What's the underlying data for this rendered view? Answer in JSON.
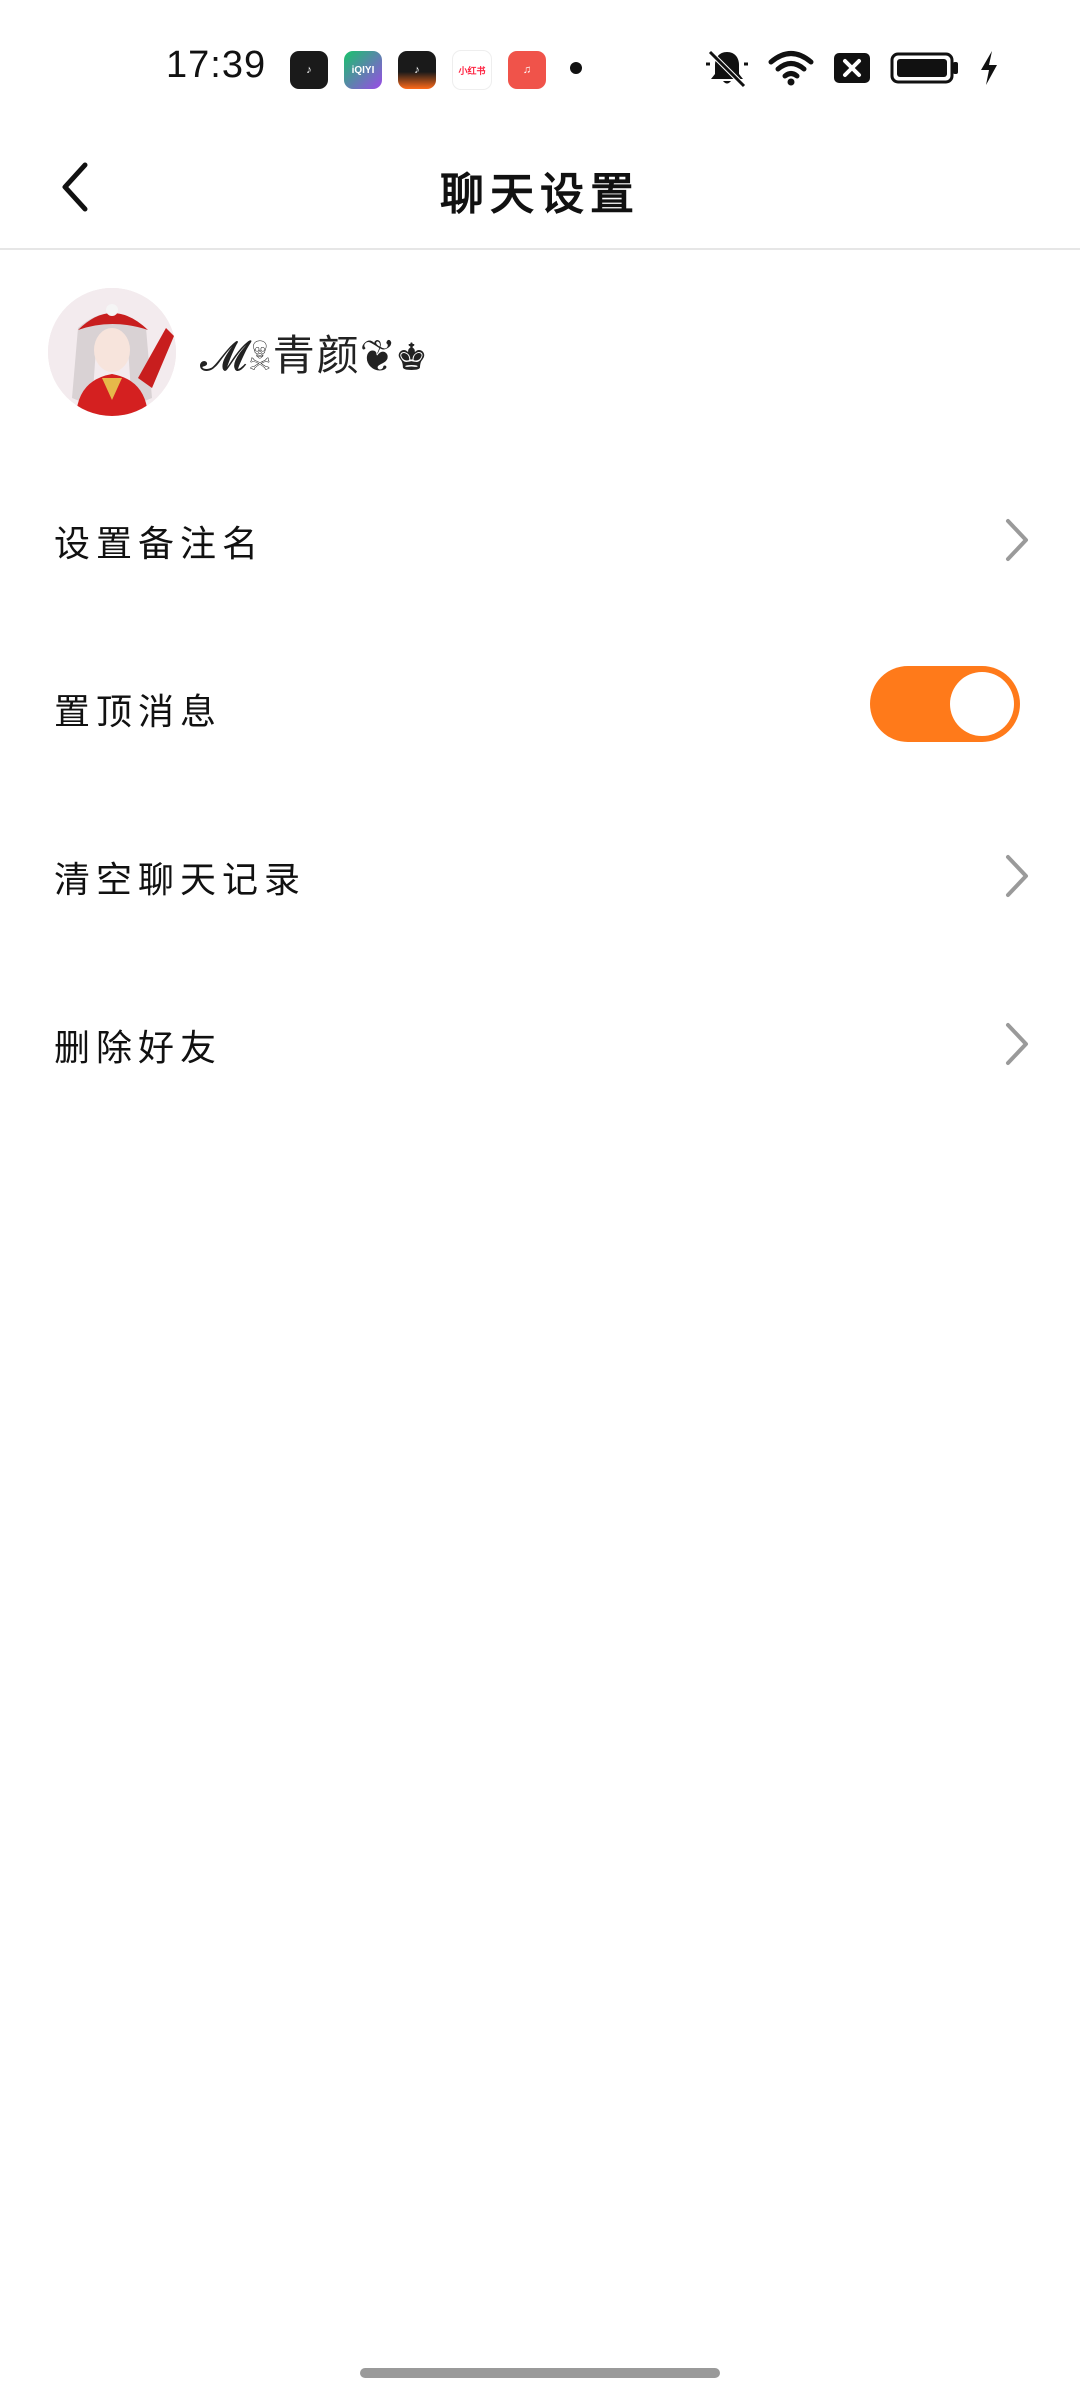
{
  "status_bar": {
    "time": "17:39",
    "app_icons": [
      {
        "name": "tiktok-app-icon",
        "glyph": "♪"
      },
      {
        "name": "iqiyi-app-icon",
        "glyph": "iQIYI"
      },
      {
        "name": "tiktok-lite-app-icon",
        "glyph": "♪"
      },
      {
        "name": "xiaohongshu-app-icon",
        "glyph": "小红书"
      },
      {
        "name": "music-app-icon",
        "glyph": "♫"
      }
    ],
    "indicators": [
      "mute-icon",
      "wifi-icon",
      "sim-off-icon",
      "battery-icon",
      "charging-icon"
    ],
    "battery_level": 1.0,
    "colors": {
      "text": "#111111"
    }
  },
  "header": {
    "back_icon": "chevron-left-icon",
    "title": "聊天设置"
  },
  "profile": {
    "name": "𝓜☠青颜❦♚"
  },
  "settings": {
    "items": [
      {
        "label": "设置备注名",
        "control": "chevron-right-icon"
      },
      {
        "label": "置顶消息",
        "control": "toggle"
      },
      {
        "label": "清空聊天记录",
        "control": "chevron-right-icon"
      },
      {
        "label": "删除好友",
        "control": "chevron-right-icon"
      }
    ],
    "pin_toggle_on": true
  },
  "colors": {
    "accent": "#ff7a1a",
    "divider": "#e6e6e6",
    "chevron": "#9a9a9a",
    "background": "#ffffff"
  }
}
